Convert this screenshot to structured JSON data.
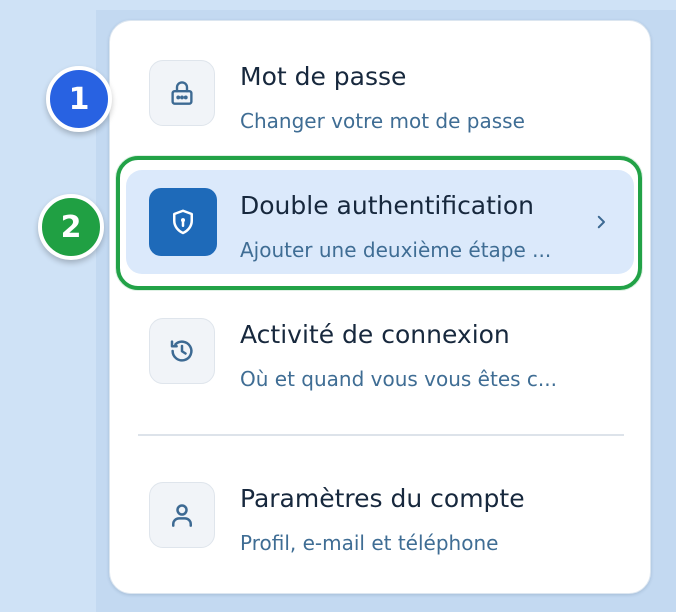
{
  "menu": {
    "items": [
      {
        "title": "Mot de passe",
        "subtitle": "Changer votre mot de passe",
        "icon": "lock-icon"
      },
      {
        "title": "Double authentification",
        "subtitle": "Ajouter une deuxième étape ...",
        "icon": "shield-lock-icon",
        "active": true,
        "chevron": "chevron-right-icon"
      },
      {
        "title": "Activité de connexion",
        "subtitle": "Où et quand vous vous êtes c...",
        "icon": "history-icon"
      },
      {
        "title": "Paramètres du compte",
        "subtitle": "Profil, e-mail et téléphone",
        "icon": "user-icon"
      }
    ]
  },
  "markers": [
    "1",
    "2"
  ],
  "colors": {
    "accent": "#1e6ab9",
    "active_bg": "#dbe9fb",
    "highlight_ring": "#22a247",
    "marker_1": "#2862e2",
    "marker_2": "#20a043",
    "subtitle": "#3f6d94"
  }
}
